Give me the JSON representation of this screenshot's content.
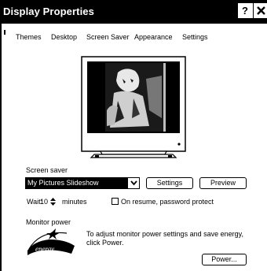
{
  "window": {
    "title": "Display Properties"
  },
  "tabs": [
    {
      "label": "Themes"
    },
    {
      "label": "Desktop"
    },
    {
      "label": "Screen Saver",
      "selected": true
    },
    {
      "label": "Appearance"
    },
    {
      "label": "Settings"
    }
  ],
  "screen_saver": {
    "group_label": "Screen saver",
    "selected": "My Pictures Slideshow",
    "settings_label": "Settings",
    "preview_label": "Preview",
    "wait_label": "Wait:",
    "wait_value": "10",
    "minutes_label": "minutes",
    "password_label": "On resume, password protect",
    "password_checked": false
  },
  "monitor_power": {
    "group_label": "Monitor power",
    "description": "To adjust monitor power settings and save energy, click Power.",
    "power_label": "Power...",
    "logo_icon": "energy-star-logo"
  },
  "icons": {
    "help": "help-icon",
    "close": "close-icon",
    "dropdown": "chevron-down-icon",
    "stepper": "up-down-stepper-icon"
  },
  "colors": {
    "titlebar": "#000000",
    "selection": "#000000",
    "background": "#ffffff"
  }
}
